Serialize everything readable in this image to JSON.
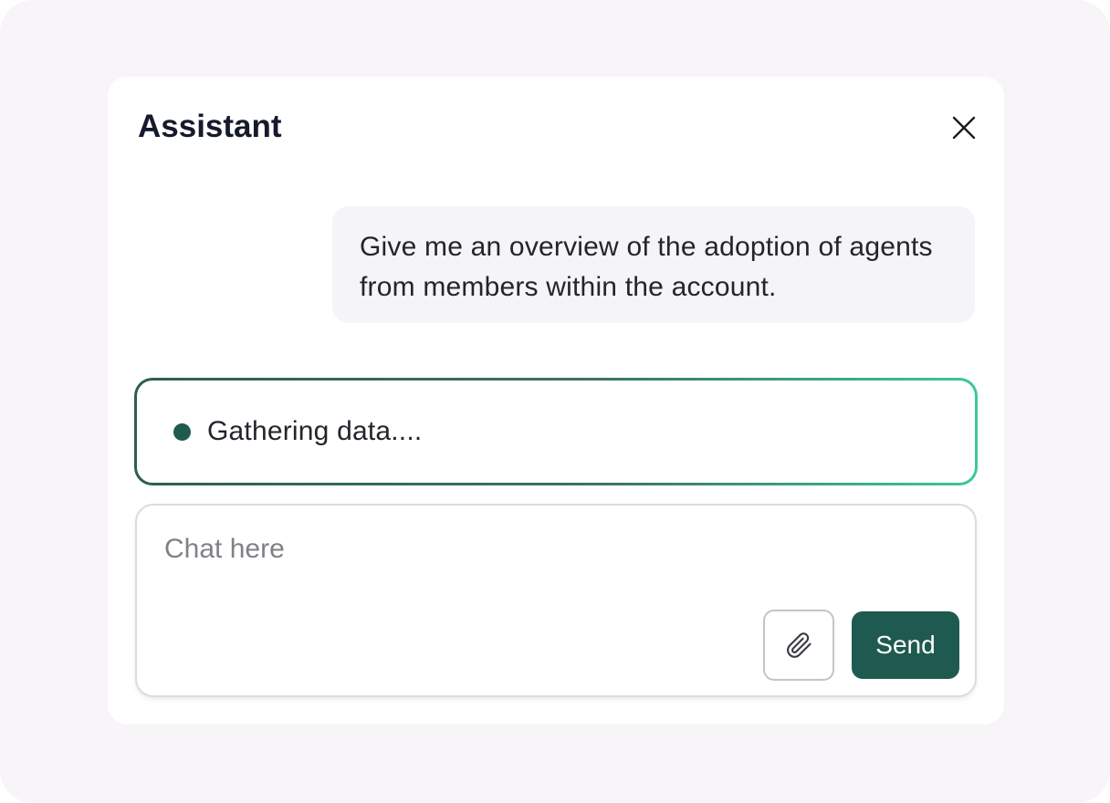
{
  "panel": {
    "title": "Assistant"
  },
  "conversation": {
    "user_message": "Give me an overview of the adoption of agents from members within the account."
  },
  "status": {
    "text": "Gathering data....",
    "dot_color": "#1f5a50"
  },
  "composer": {
    "value": "",
    "placeholder": "Chat here",
    "attach_icon": "paperclip-icon",
    "send_label": "Send"
  },
  "colors": {
    "accent": "#1f5a50",
    "gradient_end": "#3cc89c",
    "bubble_bg": "#f5f4f7",
    "backdrop": "#f7f5f7"
  },
  "icons": {
    "close": "close-icon",
    "attach": "paperclip-icon"
  }
}
